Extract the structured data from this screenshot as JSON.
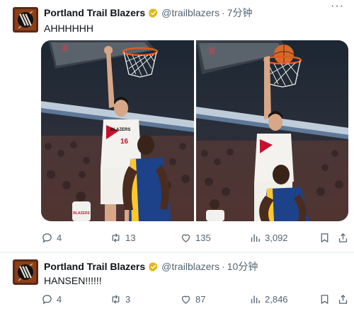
{
  "colors": {
    "text_primary": "#0f1419",
    "text_secondary": "#536471",
    "verified_gold": "#e2b719",
    "separator": "#eff3f4"
  },
  "tweets": [
    {
      "name": "Portland Trail Blazers",
      "handle": "@trailblazers",
      "separator_dot": "·",
      "time": "7分钟",
      "more": "···",
      "text": "AHHHHHH",
      "jersey_number": "16",
      "jersey_team_text": "BLAZERS",
      "background_jersey_text": "BLAZERS",
      "media_count": 2,
      "stats": {
        "replies": "4",
        "retweets": "13",
        "likes": "135",
        "views": "3,092"
      }
    },
    {
      "name": "Portland Trail Blazers",
      "handle": "@trailblazers",
      "separator_dot": "·",
      "time": "10分钟",
      "text": "HANSEN!!!!!!",
      "stats": {
        "replies": "4",
        "retweets": "3",
        "likes": "87",
        "views": "2,846"
      }
    }
  ],
  "icons": {
    "reply": "reply-icon",
    "retweet": "retweet-icon",
    "like": "heart-icon",
    "views": "bar-chart-icon",
    "bookmark": "bookmark-icon",
    "share": "share-icon",
    "verified": "verified-badge-icon"
  }
}
